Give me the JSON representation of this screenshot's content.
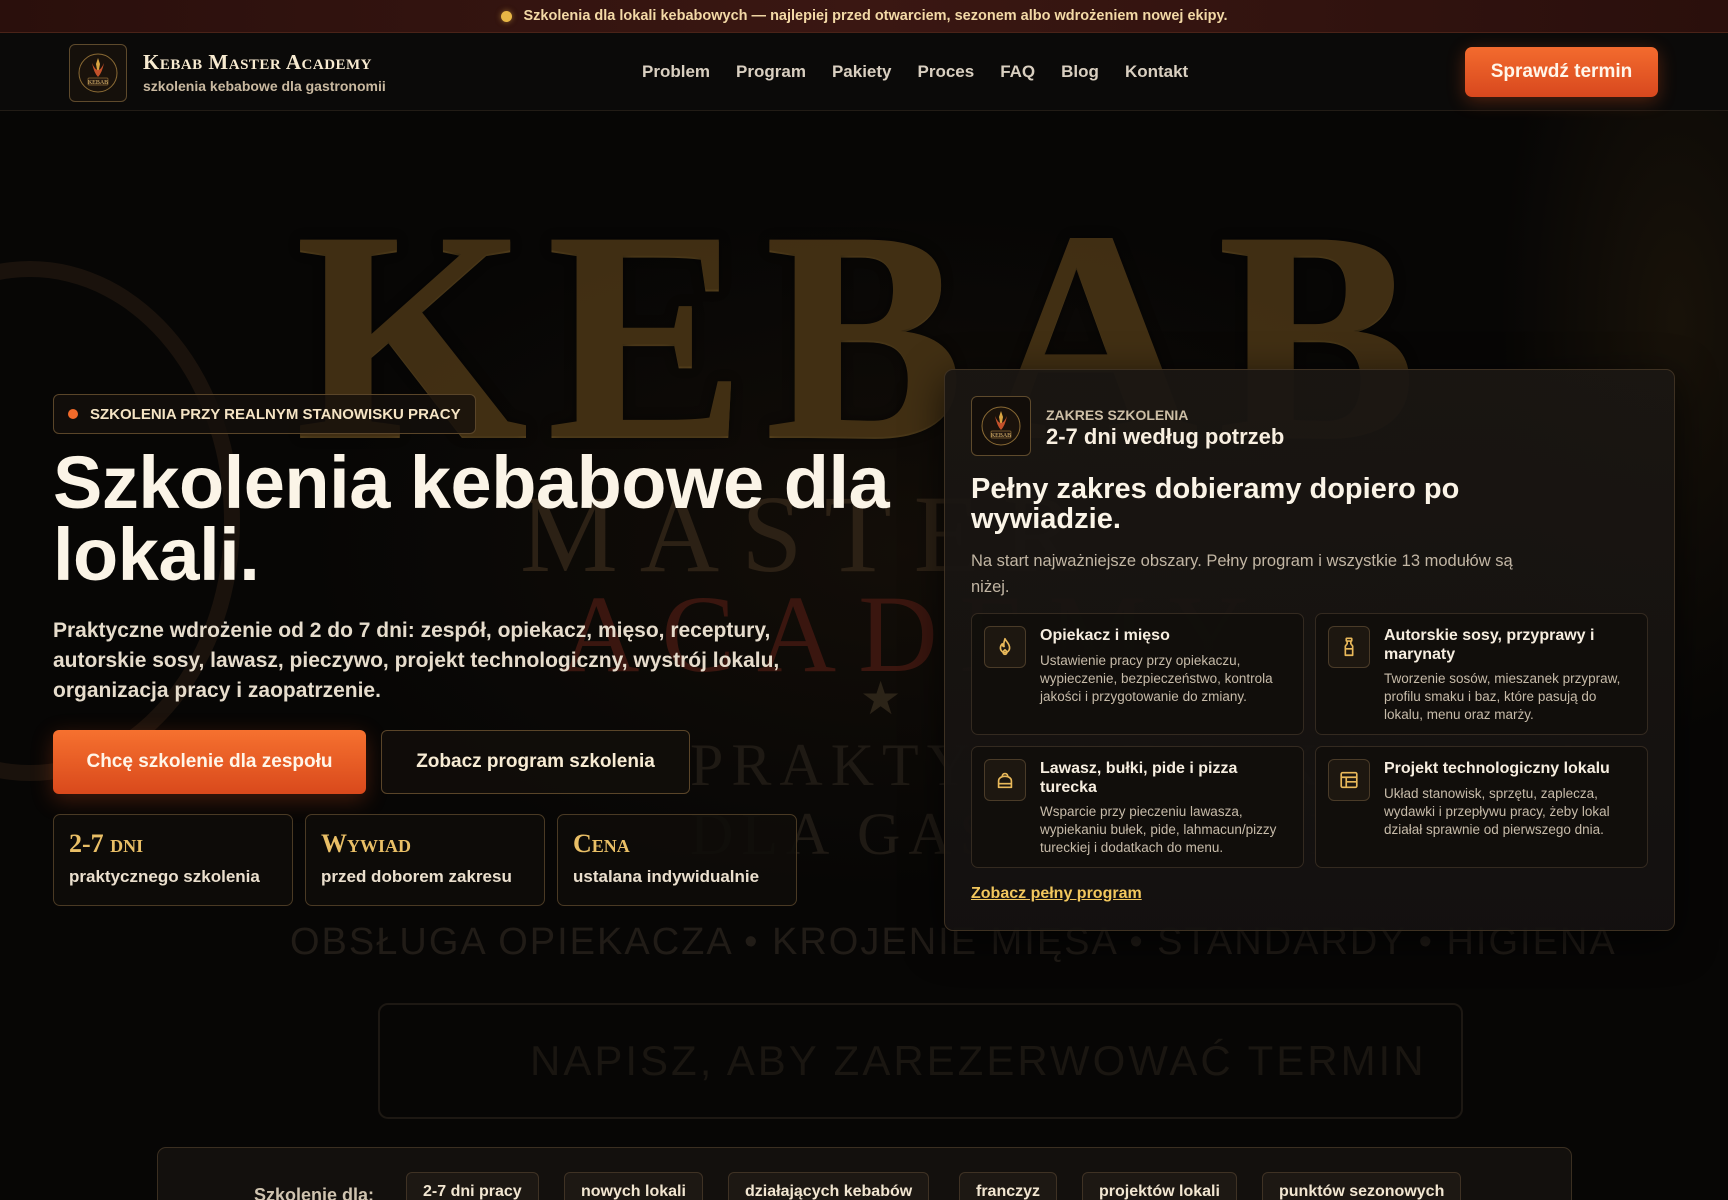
{
  "announcement": {
    "text": "Szkolenia dla lokali kebabowych — najlepiej przed otwarciem, sezonem albo wdrożeniem nowej ekipy."
  },
  "brand": {
    "logo_text": "KEBAB",
    "name": "Kebab Master Academy",
    "tagline": "szkolenia kebabowe dla gastronomii"
  },
  "nav": {
    "items": [
      "Problem",
      "Program",
      "Pakiety",
      "Proces",
      "FAQ",
      "Blog",
      "Kontakt"
    ]
  },
  "header_cta": "Sprawdź termin",
  "backdrop": {
    "word": "KEBAB",
    "line1": "MASTER",
    "line2": "ACADEMY",
    "line3": "PRAKTYCZNE SZKOLENIA DLA GASTRONOMII",
    "features": "OBSŁUGA OPIEKACZA • KROJENIE MIĘSA • STANDARDY • HIGIENA",
    "reserve": "NAPISZ, ABY ZAREZERWOWAĆ TERMIN"
  },
  "hero": {
    "eyebrow": "SZKOLENIA PRZY REALNYM STANOWISKU PRACY",
    "title": "Szkolenia kebabowe dla lokali.",
    "lead": "Praktyczne wdrożenie od 2 do 7 dni: zespół, opiekacz, mięso, receptury, autorskie sosy, lawasz, pieczywo, projekt technologiczny, wystrój lokalu, organizacja pracy i zaopatrzenie.",
    "primary_button": "Chcę szkolenie dla zespołu",
    "secondary_button": "Zobacz program szkolenia",
    "stats": [
      {
        "big": "2-7 dni",
        "small": "praktycznego szkolenia"
      },
      {
        "big": "Wywiad",
        "small": "przed doborem zakresu"
      },
      {
        "big": "Cena",
        "small": "ustalana indywidualnie"
      }
    ]
  },
  "card": {
    "eyebrow": "ZAKRES SZKOLENIA",
    "range": "2-7 dni według potrzeb",
    "title": "Pełny zakres dobieramy dopiero po wywiadzie.",
    "description": "Na start najważniejsze obszary. Pełny program i wszystkie 13 modułów są niżej.",
    "modules": [
      {
        "icon": "flame-icon",
        "title": "Opiekacz i mięso",
        "desc": "Ustawienie pracy przy opiekaczu, wypieczenie, bezpieczeństwo, kontrola jakości i przygotowanie do zmiany."
      },
      {
        "icon": "sauce-bottle-icon",
        "title": "Autorskie sosy, przyprawy i marynaty",
        "desc": "Tworzenie sosów, mieszanek przypraw, profilu smaku i baz, które pasują do lokalu, menu oraz marży."
      },
      {
        "icon": "bread-icon",
        "title": "Lawasz, bułki, pide i pizza turecka",
        "desc": "Wsparcie przy pieczeniu lawasza, wypiekaniu bułek, pide, lahmacun/pizzy tureckiej i dodatkach do menu."
      },
      {
        "icon": "layout-plan-icon",
        "title": "Projekt technologiczny lokalu",
        "desc": "Układ stanowisk, sprzętu, zaplecza, wydawki i przepływu pracy, żeby lokal działał sprawnie od pierwszego dnia."
      }
    ],
    "link": "Zobacz pełny program"
  },
  "strip": {
    "label": "Szkolenie dla:",
    "chips": [
      "2-7 dni pracy",
      "nowych lokali",
      "działających kebabów",
      "franczyz",
      "projektów lokali",
      "punktów sezonowych"
    ]
  },
  "colors": {
    "accent": "#f26a2a",
    "gold": "#e9bf66",
    "background": "#070605"
  }
}
